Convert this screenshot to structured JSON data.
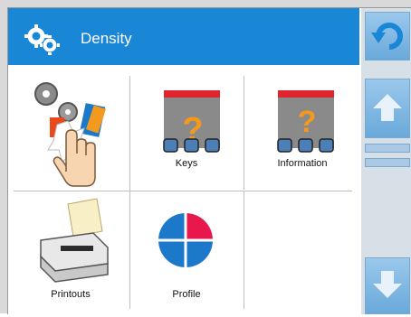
{
  "header": {
    "title": "Density",
    "icon": "gears-icon"
  },
  "tiles": [
    {
      "label": "",
      "icon": "settings-gears-with-hand-icon"
    },
    {
      "label": "Keys",
      "icon": "keys-help-icon"
    },
    {
      "label": "Information",
      "icon": "information-help-icon"
    },
    {
      "label": "Printouts",
      "icon": "printer-icon"
    },
    {
      "label": "Profile",
      "icon": "profile-pie-icon"
    },
    {
      "label": "",
      "icon": ""
    }
  ],
  "side": {
    "back": "undo-icon",
    "up": "arrow-up-icon",
    "down": "arrow-down-icon"
  },
  "colors": {
    "header": "#1a86d6",
    "accent_red": "#e8184c",
    "accent_blue": "#1c78c8",
    "question": "#f39a1e"
  }
}
